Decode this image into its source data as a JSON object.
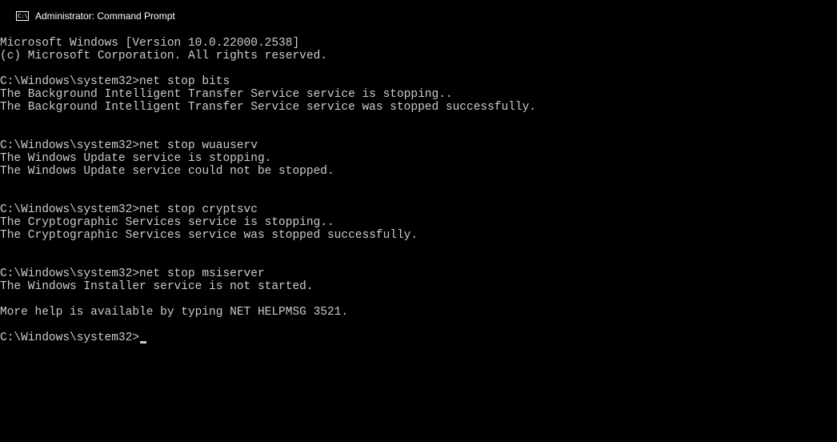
{
  "titlebar": {
    "title": "Administrator: Command Prompt"
  },
  "terminal": {
    "header_version": "Microsoft Windows [Version 10.0.22000.2538]",
    "header_copyright": "(c) Microsoft Corporation. All rights reserved.",
    "blocks": [
      {
        "prompt": "C:\\Windows\\system32>",
        "command": "net stop bits",
        "output": [
          "The Background Intelligent Transfer Service service is stopping..",
          "The Background Intelligent Transfer Service service was stopped successfully."
        ]
      },
      {
        "prompt": "C:\\Windows\\system32>",
        "command": "net stop wuauserv",
        "output": [
          "The Windows Update service is stopping.",
          "The Windows Update service could not be stopped."
        ]
      },
      {
        "prompt": "C:\\Windows\\system32>",
        "command": "net stop cryptsvc",
        "output": [
          "The Cryptographic Services service is stopping..",
          "The Cryptographic Services service was stopped successfully."
        ]
      },
      {
        "prompt": "C:\\Windows\\system32>",
        "command": "net stop msiserver",
        "output": [
          "The Windows Installer service is not started.",
          "",
          "More help is available by typing NET HELPMSG 3521."
        ]
      }
    ],
    "current_prompt": "C:\\Windows\\system32>"
  }
}
